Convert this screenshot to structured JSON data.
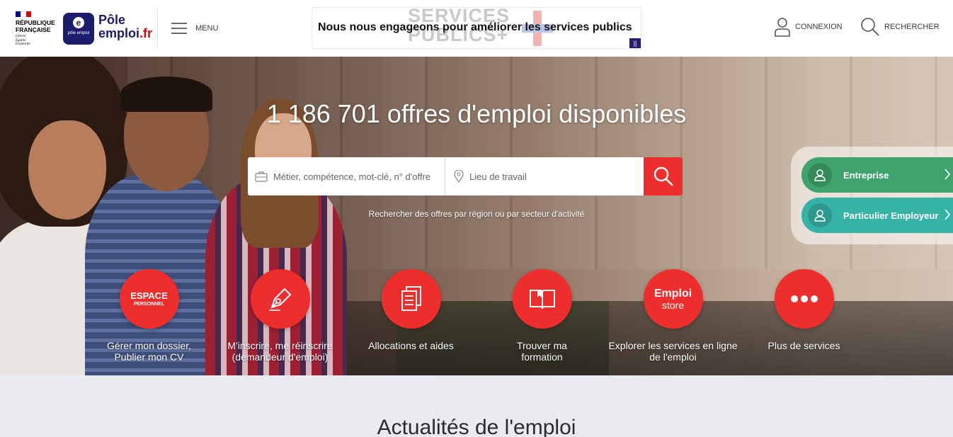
{
  "header": {
    "republique": {
      "line1": "RÉPUBLIQUE",
      "line2": "FRANÇAISE",
      "motto": [
        "Liberté",
        "Égalité",
        "Fraternité"
      ],
      "flag_colors": [
        "#000091",
        "#ffffff",
        "#e1000f"
      ]
    },
    "pole_emploi": {
      "logo_small": "pôle emploi",
      "logo_letter": "e",
      "name_line1": "Pôle",
      "name_line2_a": "emploi",
      "name_line2_b": ".fr"
    },
    "menu_label": "MENU",
    "banner": {
      "background_text_1": "SERVICES",
      "background_text_2": "PUBLICS+",
      "text": "Nous nous engageons pour améliorer les services publics"
    },
    "connexion_label": "CONNEXION",
    "rechercher_label": "RECHERCHER"
  },
  "hero": {
    "title": "1 186 701 offres d'emploi disponibles",
    "search": {
      "job_placeholder": "Métier, compétence, mot-clé, n° d'offre",
      "location_placeholder": "Lieu de travail"
    },
    "region_link": "Rechercher des offres par région ou par secteur d'activité",
    "side_buttons": [
      {
        "label": "Entreprise",
        "color": "#3fa36d"
      },
      {
        "label": "Particulier Employeur",
        "color": "#36b3a7"
      }
    ]
  },
  "services": [
    {
      "icon": "espace-personnel-icon",
      "icon_text_1": "ESPACE",
      "icon_text_2": "PERSONNEL",
      "label_1": "Gérer mon dossier,",
      "label_2": "Publier mon CV"
    },
    {
      "icon": "pen-nib-icon",
      "label_1": "M'inscrire, me réinscrire",
      "label_2": "(demandeur d'emploi)"
    },
    {
      "icon": "documents-icon",
      "label_1": "Allocations et aides",
      "label_2": ""
    },
    {
      "icon": "open-book-icon",
      "label_1": "Trouver ma",
      "label_2": "formation"
    },
    {
      "icon": "emploi-store-icon",
      "icon_text_1": "Emploi",
      "icon_text_2": "store",
      "label_1": "Explorer les services en ligne",
      "label_2": "de l'emploi"
    },
    {
      "icon": "more-dots-icon",
      "label_1": "Plus de services",
      "label_2": ""
    }
  ],
  "news": {
    "title": "Actualités de l'emploi"
  },
  "colors": {
    "accent_red": "#ee2d2d",
    "brand_navy": "#1c1c6f",
    "page_bg": "#e9ebf0"
  }
}
